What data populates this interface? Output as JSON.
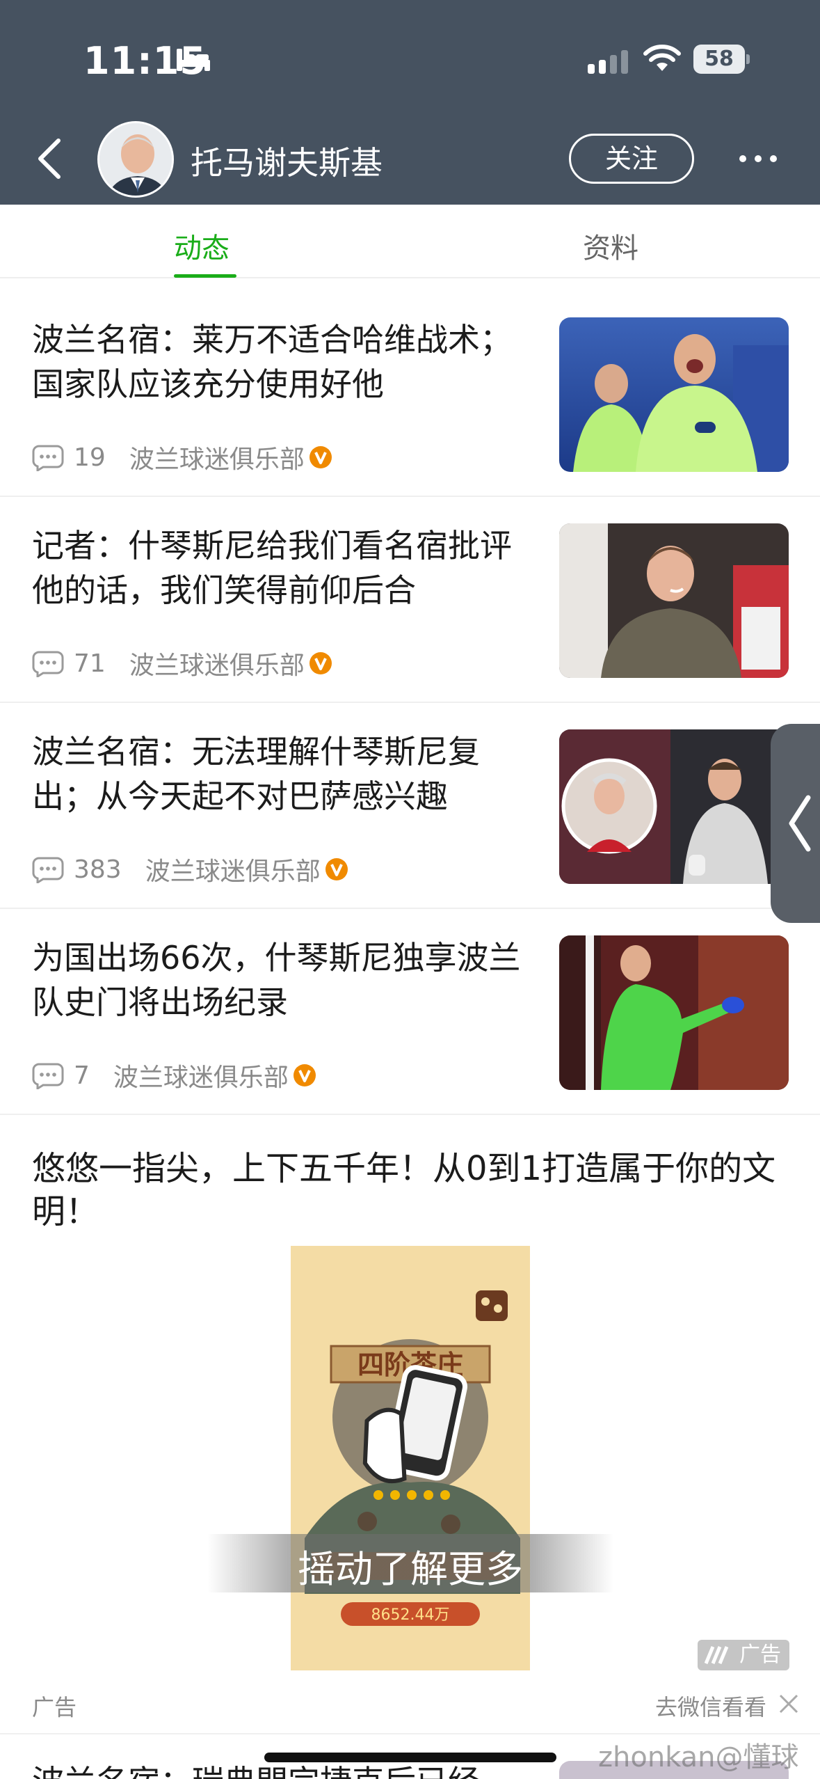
{
  "status_bar": {
    "time": "11:15",
    "battery": "58"
  },
  "header": {
    "name": "托马谢夫斯基",
    "follow_label": "关注"
  },
  "tabs": [
    {
      "label": "动态"
    },
    {
      "label": "资料"
    }
  ],
  "feed": [
    {
      "title": "波兰名宿：莱万不适合哈维战术；国家队应该充分使用好他",
      "comments": "19",
      "source": "波兰球迷俱乐部"
    },
    {
      "title": "记者：什琴斯尼给我们看名宿批评他的话，我们笑得前仰后合",
      "comments": "71",
      "source": "波兰球迷俱乐部"
    },
    {
      "title": "波兰名宿：无法理解什琴斯尼复出；从今天起不对巴萨感兴趣",
      "comments": "383",
      "source": "波兰球迷俱乐部"
    },
    {
      "title": "为国出场66次，什琴斯尼独享波兰队史门将出场纪录",
      "comments": "7",
      "source": "波兰球迷俱乐部"
    }
  ],
  "ad": {
    "title": "悠悠一指尖，上下五千年！从0到1打造属于你的文明！",
    "poster_sign": "四阶茶庄",
    "poster_price": "8652.44万",
    "shake_text": "摇动了解更多",
    "badge": "广告",
    "label": "广告",
    "link_text": "去微信看看"
  },
  "next_item": {
    "title": "波兰名宿：瑞典門完捷克后已经"
  },
  "watermark": "zhonkan@懂球帝",
  "colors": {
    "header_bg": "#465260",
    "accent_green": "#1aad19",
    "verified_orange": "#f08a00"
  }
}
